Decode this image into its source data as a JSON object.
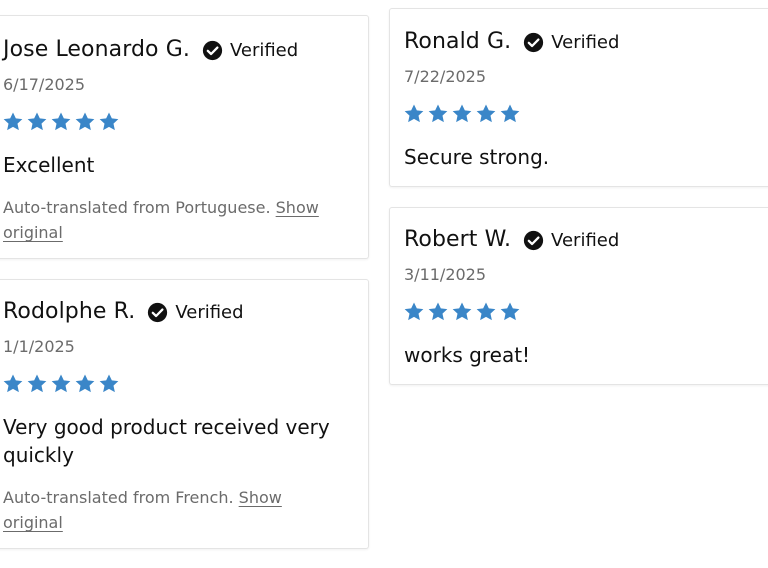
{
  "colors": {
    "star": "#3a86c8",
    "text": "#111111",
    "muted": "#6b6b6b",
    "border": "#e4e4e4"
  },
  "icons": {
    "verified": "check-circle-icon",
    "star": "star-icon"
  },
  "reviews": [
    {
      "name": "Jose Leonardo G.",
      "verified_label": "Verified",
      "date": "6/17/2025",
      "rating": 5,
      "body": "Excellent",
      "translation_note": "Auto-translated from Portuguese.",
      "show_original_part1": "Show",
      "show_original_part2": "original"
    },
    {
      "name": "Rodolphe R.",
      "verified_label": "Verified",
      "date": "1/1/2025",
      "rating": 5,
      "body_line1": "Very good product received very",
      "body_line2": "quickly",
      "translation_note": "Auto-translated from French.",
      "show_original_part1": "Show",
      "show_original_part2": "original"
    },
    {
      "name": "Ronald G.",
      "verified_label": "Verified",
      "date": "7/22/2025",
      "rating": 5,
      "body": "Secure strong."
    },
    {
      "name": "Robert W.",
      "verified_label": "Verified",
      "date": "3/11/2025",
      "rating": 5,
      "body": "works great!"
    }
  ]
}
